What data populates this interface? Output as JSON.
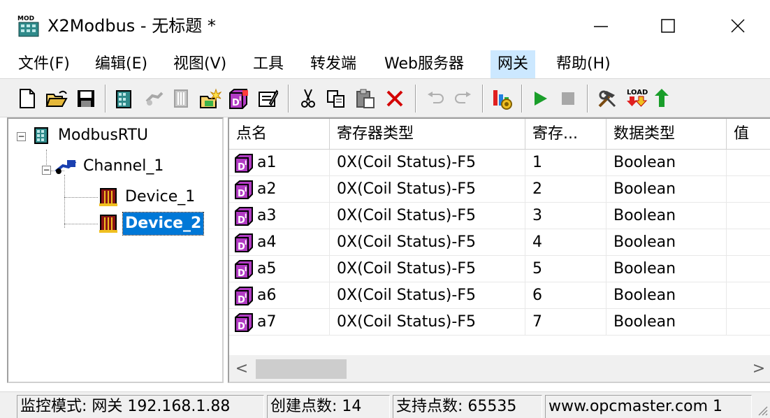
{
  "window": {
    "icon_text": "MOD",
    "title": "X2Modbus - 无标题 *",
    "minimize_symbol": "—",
    "maximize_symbol": "☐",
    "close_symbol": "✕"
  },
  "menu": [
    {
      "label": "文件(F)",
      "active": false
    },
    {
      "label": "编辑(E)",
      "active": false
    },
    {
      "label": "视图(V)",
      "active": false
    },
    {
      "label": "工具",
      "active": false
    },
    {
      "label": "转发端",
      "active": false
    },
    {
      "label": "Web服务器",
      "active": false
    },
    {
      "label": "网关",
      "active": true
    },
    {
      "label": "帮助(H)",
      "active": false
    }
  ],
  "toolbar": {
    "buttons": [
      "new-file-icon",
      "open-folder-icon",
      "save-icon",
      "add-channel-icon",
      "add-device-icon",
      "device-props-icon",
      "new-group-icon",
      "add-tag-icon",
      "properties-icon",
      "cut-icon",
      "copy-icon",
      "paste-icon",
      "delete-icon",
      "undo-icon",
      "redo-icon",
      "monitor-icon",
      "run-icon",
      "stop-icon",
      "tools-icon",
      "load-icon",
      "upload-icon"
    ],
    "load_text": "LOAD"
  },
  "tree": {
    "root": "ModbusRTU",
    "channel": "Channel_1",
    "devices": [
      "Device_1",
      "Device_2"
    ],
    "selected": "Device_2",
    "collapse_symbol": "−"
  },
  "list": {
    "columns": [
      "点名",
      "寄存器类型",
      "寄存...",
      "数据类型",
      "值"
    ],
    "rows": [
      {
        "name": "a1",
        "register_type": "0X(Coil Status)-F5",
        "register": "1",
        "data_type": "Boolean",
        "value": ""
      },
      {
        "name": "a2",
        "register_type": "0X(Coil Status)-F5",
        "register": "2",
        "data_type": "Boolean",
        "value": ""
      },
      {
        "name": "a3",
        "register_type": "0X(Coil Status)-F5",
        "register": "3",
        "data_type": "Boolean",
        "value": ""
      },
      {
        "name": "a4",
        "register_type": "0X(Coil Status)-F5",
        "register": "4",
        "data_type": "Boolean",
        "value": ""
      },
      {
        "name": "a5",
        "register_type": "0X(Coil Status)-F5",
        "register": "5",
        "data_type": "Boolean",
        "value": ""
      },
      {
        "name": "a6",
        "register_type": "0X(Coil Status)-F5",
        "register": "6",
        "data_type": "Boolean",
        "value": ""
      },
      {
        "name": "a7",
        "register_type": "0X(Coil Status)-F5",
        "register": "7",
        "data_type": "Boolean",
        "value": ""
      }
    ],
    "scroll_left": "<",
    "scroll_right": ">"
  },
  "statusbar": {
    "mode": "监控模式: 网关 192.168.1.88",
    "created": "创建点数: 14",
    "supported": "支持点数: 65535",
    "website": "www.opcmaster.com 1"
  },
  "colors": {
    "selection": "#0078d7",
    "menu_active": "#cce8ff",
    "run_green": "#1a9e2a",
    "delete_red": "#d40000",
    "tag_purple": "#9b2fae"
  }
}
